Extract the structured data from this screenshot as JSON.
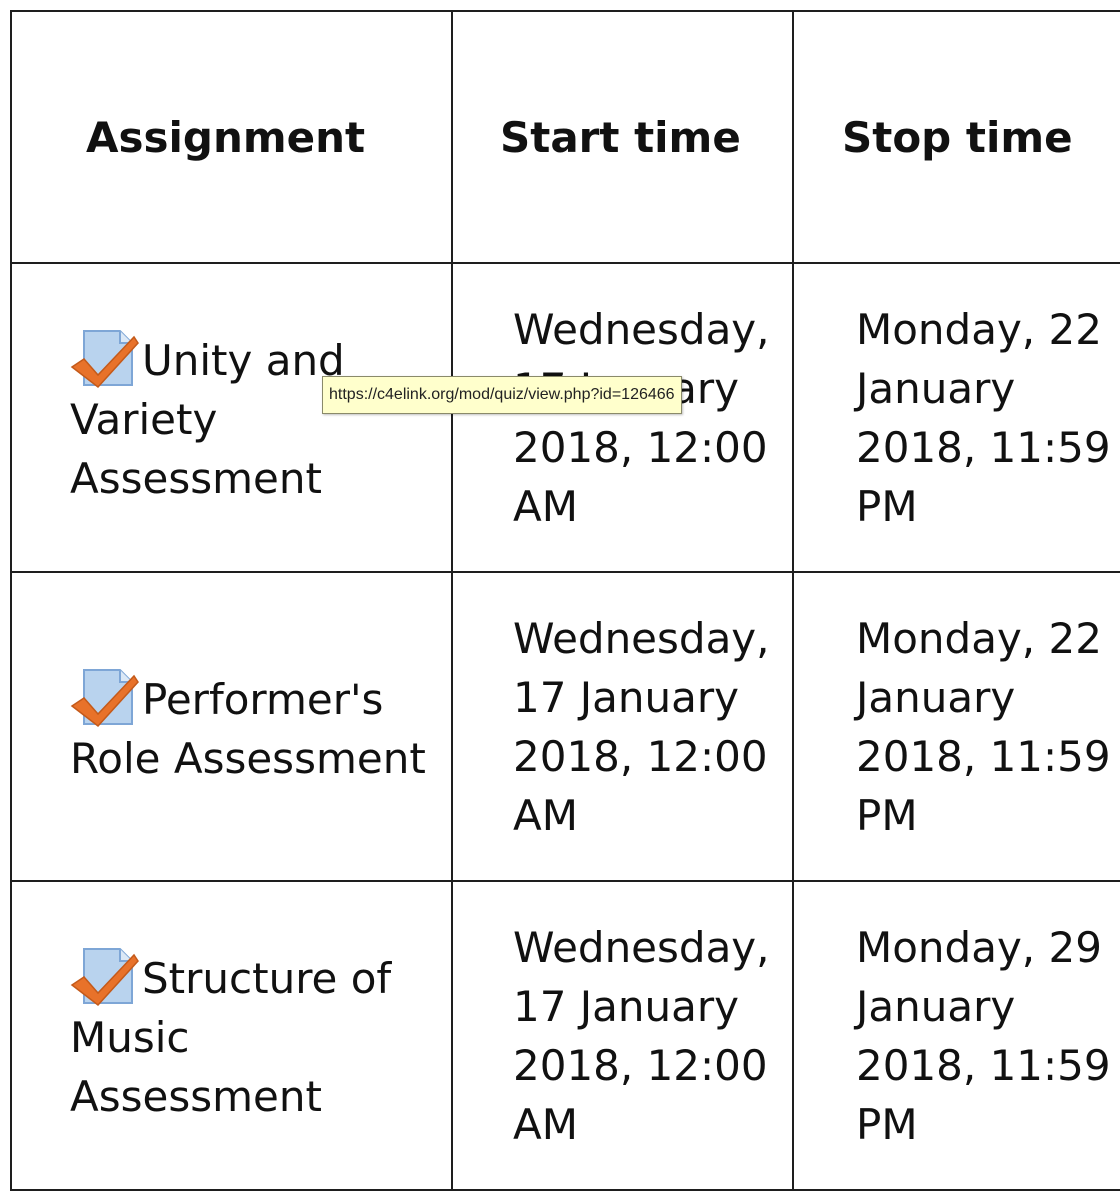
{
  "table": {
    "headers": {
      "assignment": "Assignment",
      "start": "Start time",
      "stop": "Stop time"
    },
    "rows": [
      {
        "icon": "quiz-icon",
        "name": "Unity and Variety Assessment",
        "start": "Wednesday, 17 January 2018, 12:00 AM",
        "stop": "Monday, 22 January 2018, 11:59 PM"
      },
      {
        "icon": "quiz-icon",
        "name": "Performer's Role Assessment",
        "start": "Wednesday, 17 January 2018, 12:00 AM",
        "stop": "Monday, 22 January 2018, 11:59 PM"
      },
      {
        "icon": "quiz-icon",
        "name": "Structure of Music Assessment",
        "start": "Wednesday, 17 January 2018, 12:00 AM",
        "stop": "Monday, 29 January 2018, 11:59 PM"
      }
    ]
  },
  "tooltip": {
    "text": "https://c4elink.org/mod/quiz/view.php?id=126466"
  },
  "colors": {
    "checkmark": "#e8722a",
    "page_icon": "#b9d3ee",
    "tooltip_bg": "#ffffcc"
  }
}
